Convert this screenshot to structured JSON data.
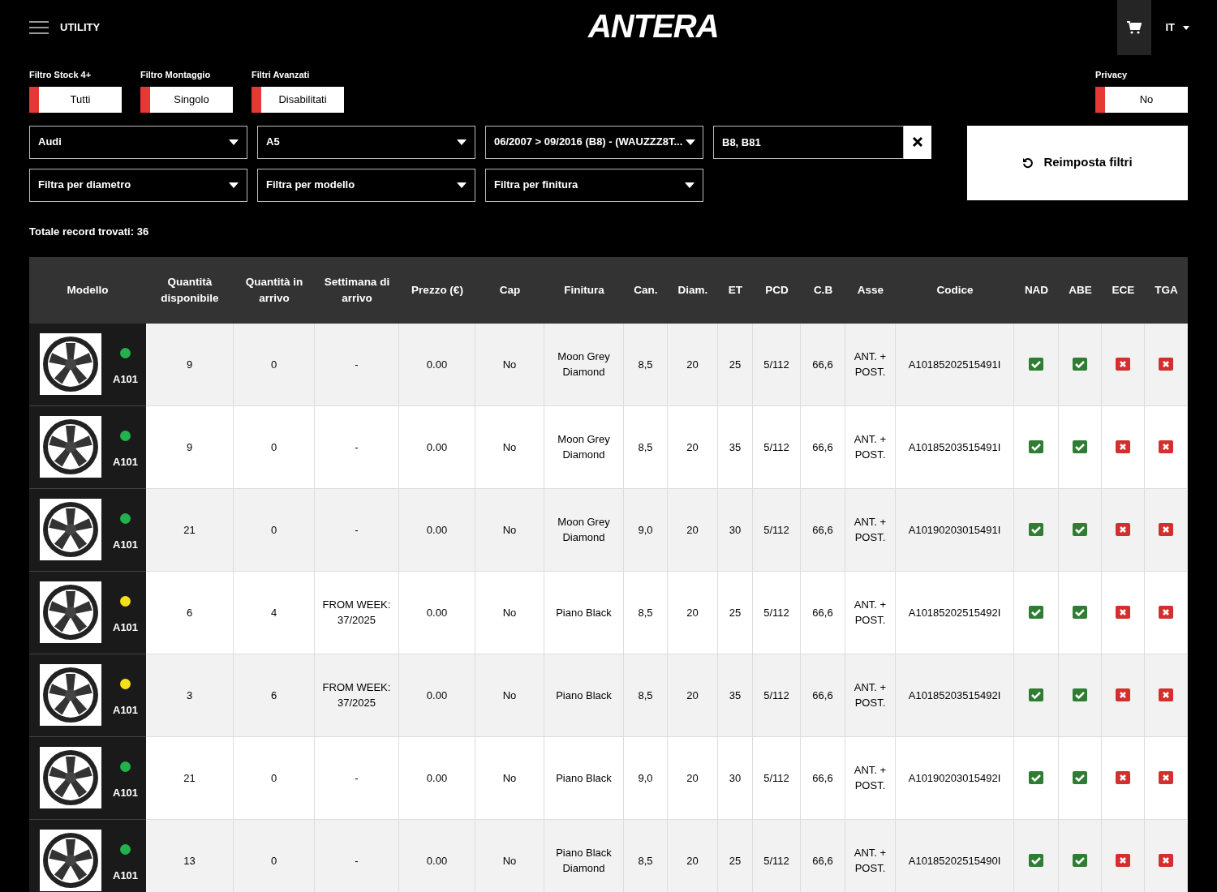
{
  "header": {
    "menu_label": "UTILITY",
    "logo": "ANTERA",
    "language": "IT"
  },
  "toggles": [
    {
      "label": "Filtro Stock 4+",
      "value": "Tutti"
    },
    {
      "label": "Filtro Montaggio",
      "value": "Singolo"
    },
    {
      "label": "Filtri Avanzati",
      "value": "Disabilitati"
    }
  ],
  "privacy": {
    "label": "Privacy",
    "value": "No"
  },
  "selects_row1": [
    "Audi",
    "A5",
    "06/2007 > 09/2016 (B8) - (WAUZZZ8T..."
  ],
  "search": {
    "value": "B8, B81"
  },
  "selects_row2": [
    "Filtra per diametro",
    "Filtra per modello",
    "Filtra per finitura"
  ],
  "reset_button": "Reimposta filtri",
  "total": "Totale record trovati: 36",
  "table": {
    "columns": [
      "Modello",
      "Quantità disponibile",
      "Quantità in arrivo",
      "Settimana di arrivo",
      "Prezzo (€)",
      "Cap",
      "Finitura",
      "Can.",
      "Diam.",
      "ET",
      "PCD",
      "C.B",
      "Asse",
      "Codice",
      "NAD",
      "ABE",
      "ECE",
      "TGA"
    ],
    "rows": [
      {
        "color": "#22b14c",
        "cells": [
          "A101",
          "9",
          "0",
          "-",
          "0.00",
          "No",
          "Moon Grey Diamond",
          "8,5",
          "20",
          "25",
          "5/112",
          "66,6",
          "ANT. + POST.",
          "A10185202515491I"
        ],
        "certifications": [
          true,
          true,
          false,
          false
        ]
      },
      {
        "color": "#22b14c",
        "cells": [
          "A101",
          "9",
          "0",
          "-",
          "0.00",
          "No",
          "Moon Grey Diamond",
          "8,5",
          "20",
          "35",
          "5/112",
          "66,6",
          "ANT. + POST.",
          "A10185203515491I"
        ],
        "certifications": [
          true,
          true,
          false,
          false
        ]
      },
      {
        "color": "#22b14c",
        "cells": [
          "A101",
          "21",
          "0",
          "-",
          "0.00",
          "No",
          "Moon Grey Diamond",
          "9,0",
          "20",
          "30",
          "5/112",
          "66,6",
          "ANT. + POST.",
          "A10190203015491I"
        ],
        "certifications": [
          true,
          true,
          false,
          false
        ]
      },
      {
        "color": "#f5e11b",
        "cells": [
          "A101",
          "6",
          "4",
          "FROM WEEK: 37/2025",
          "0.00",
          "No",
          "Piano Black",
          "8,5",
          "20",
          "25",
          "5/112",
          "66,6",
          "ANT. + POST.",
          "A10185202515492I"
        ],
        "certifications": [
          true,
          true,
          false,
          false
        ]
      },
      {
        "color": "#f5e11b",
        "cells": [
          "A101",
          "3",
          "6",
          "FROM WEEK: 37/2025",
          "0.00",
          "No",
          "Piano Black",
          "8,5",
          "20",
          "35",
          "5/112",
          "66,6",
          "ANT. + POST.",
          "A10185203515492I"
        ],
        "certifications": [
          true,
          true,
          false,
          false
        ]
      },
      {
        "color": "#22b14c",
        "cells": [
          "A101",
          "21",
          "0",
          "-",
          "0.00",
          "No",
          "Piano Black",
          "9,0",
          "20",
          "30",
          "5/112",
          "66,6",
          "ANT. + POST.",
          "A10190203015492I"
        ],
        "certifications": [
          true,
          true,
          false,
          false
        ]
      },
      {
        "color": "#22b14c",
        "cells": [
          "A101",
          "13",
          "0",
          "-",
          "0.00",
          "No",
          "Piano Black Diamond",
          "8,5",
          "20",
          "25",
          "5/112",
          "66,6",
          "ANT. + POST.",
          "A10185202515490I"
        ],
        "certifications": [
          true,
          true,
          false,
          false
        ]
      }
    ]
  }
}
